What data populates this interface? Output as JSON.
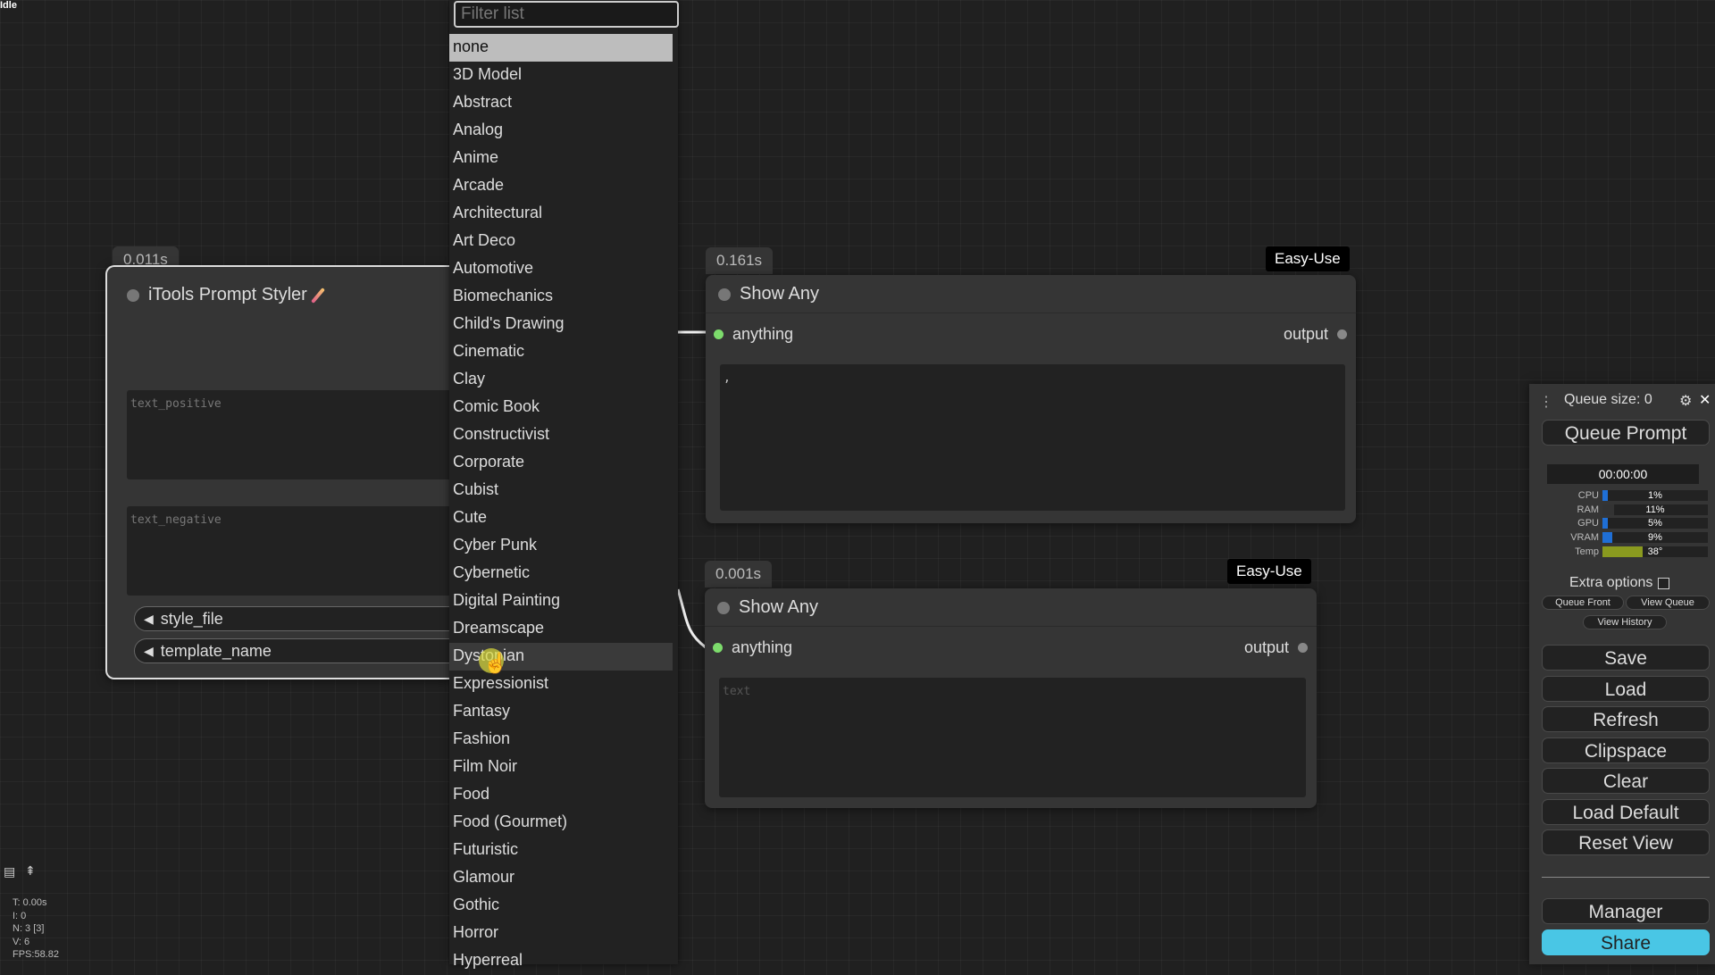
{
  "status": "Idle",
  "dropdown": {
    "filter_placeholder": "Filter list",
    "items": [
      "none",
      "3D Model",
      "Abstract",
      "Analog",
      "Anime",
      "Arcade",
      "Architectural",
      "Art Deco",
      "Automotive",
      "Biomechanics",
      "Child's Drawing",
      "Cinematic",
      "Clay",
      "Comic Book",
      "Constructivist",
      "Corporate",
      "Cubist",
      "Cute",
      "Cyber Punk",
      "Cybernetic",
      "Digital Painting",
      "Dreamscape",
      "Dystopian",
      "Expressionist",
      "Fantasy",
      "Fashion",
      "Film Noir",
      "Food",
      "Food (Gourmet)",
      "Futuristic",
      "Glamour",
      "Gothic",
      "Horror",
      "Hyperreal"
    ],
    "selected": "none",
    "hovered": "Dystopian"
  },
  "styler_node": {
    "time": "0.011s",
    "title": "iTools Prompt Styler",
    "text_positive": "text_positive",
    "text_negative": "text_negative",
    "style_file": "style_file",
    "template_name": "template_name"
  },
  "show_any_1": {
    "time": "0.161s",
    "badge": "Easy-Use",
    "title": "Show Any",
    "input": "anything",
    "output": "output",
    "content": ","
  },
  "show_any_2": {
    "time": "0.001s",
    "badge": "Easy-Use",
    "title": "Show Any",
    "input": "anything",
    "output": "output",
    "placeholder": "text"
  },
  "menu": {
    "queue_size": "Queue size: 0",
    "queue_prompt": "Queue Prompt",
    "timer": "00:00:00",
    "monitor": [
      {
        "label": "CPU",
        "value": "1%",
        "fraction": 0.01,
        "color": "#1f6fd6"
      },
      {
        "label": "RAM",
        "value": "11%",
        "fraction": 0.11,
        "color": "#333"
      },
      {
        "label": "GPU",
        "value": "5%",
        "fraction": 0.05,
        "color": "#1f6fd6"
      },
      {
        "label": "VRAM",
        "value": "9%",
        "fraction": 0.09,
        "color": "#1f6fd6"
      },
      {
        "label": "Temp",
        "value": "38°",
        "fraction": 0.38,
        "color": "#8a9a1f"
      }
    ],
    "extra_options": "Extra options",
    "queue_front": "Queue Front",
    "view_queue": "View Queue",
    "view_history": "View History",
    "buttons": [
      "Save",
      "Load",
      "Refresh",
      "Clipspace",
      "Clear",
      "Load Default",
      "Reset View"
    ],
    "manager": "Manager",
    "share": "Share",
    "share_color": "#49c6e5"
  },
  "stats": [
    "T: 0.00s",
    "I: 0",
    "N: 3 [3]",
    "V: 6",
    "FPS:58.82"
  ]
}
